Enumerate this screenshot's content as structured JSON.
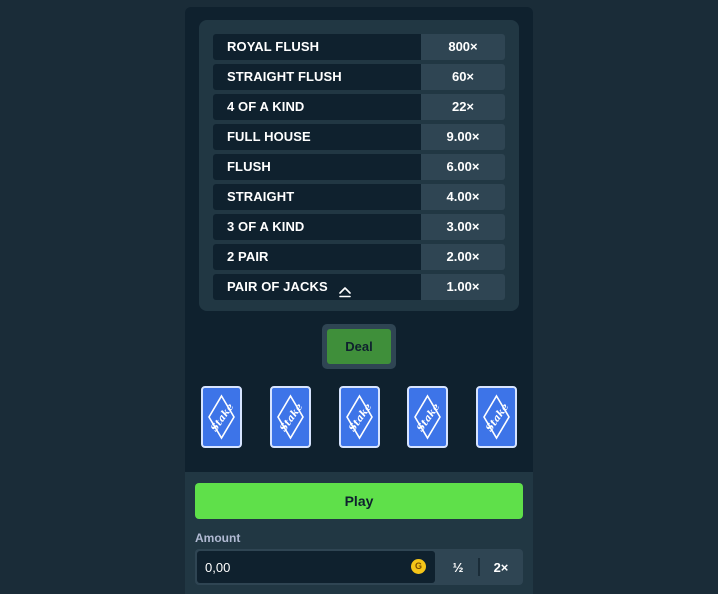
{
  "paytable": {
    "rows": [
      {
        "hand": "ROYAL FLUSH",
        "multiplier": "800×"
      },
      {
        "hand": "STRAIGHT FLUSH",
        "multiplier": "60×"
      },
      {
        "hand": "4 OF A KIND",
        "multiplier": "22×"
      },
      {
        "hand": "FULL HOUSE",
        "multiplier": "9.00×"
      },
      {
        "hand": "FLUSH",
        "multiplier": "6.00×"
      },
      {
        "hand": "STRAIGHT",
        "multiplier": "4.00×"
      },
      {
        "hand": "3 OF A KIND",
        "multiplier": "3.00×"
      },
      {
        "hand": "2 PAIR",
        "multiplier": "2.00×"
      },
      {
        "hand": "PAIR OF JACKS",
        "multiplier": "1.00×",
        "icon": "chevron-up-icon"
      }
    ]
  },
  "deal": {
    "label": "Deal"
  },
  "cards": {
    "back_text": "Stake",
    "count": 5
  },
  "play": {
    "label": "Play"
  },
  "amount": {
    "label": "Amount",
    "value": "0,00",
    "currency_symbol": "G",
    "half_label": "½",
    "double_label": "2×"
  },
  "colors": {
    "background": "#1a2c38",
    "panel": "#0f212e",
    "accent_green": "#5fe04a",
    "deal_green": "#3f8f3a",
    "card_blue": "#3d74e8",
    "coin_gold": "#f5c518"
  }
}
